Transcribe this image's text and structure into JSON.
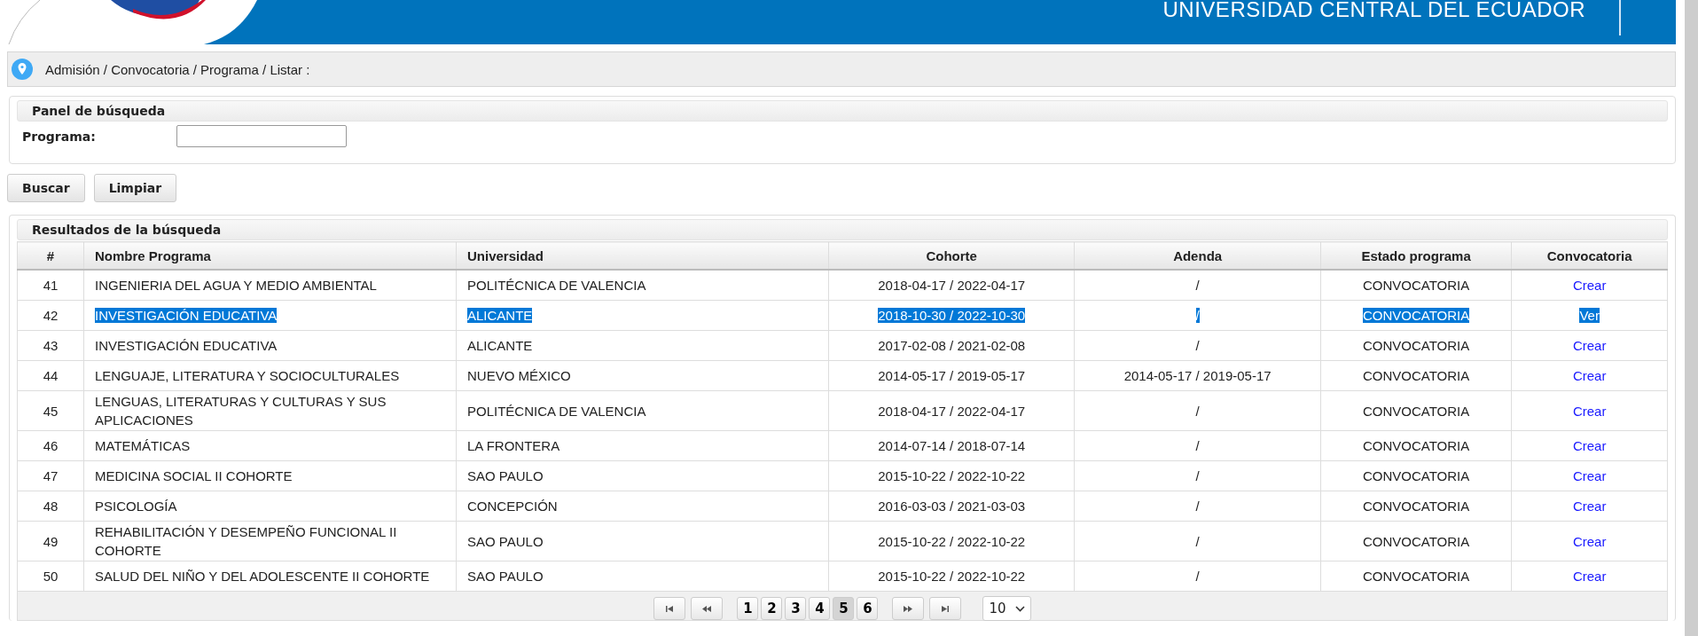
{
  "header": {
    "title": "UNIVERSIDAD CENTRAL DEL ECUADOR"
  },
  "breadcrumb": "Admisión / Convocatoria / Programa / Listar :",
  "search_panel": {
    "title": "Panel de búsqueda",
    "label": "Programa:"
  },
  "buttons": [
    "Buscar",
    "Limpiar"
  ],
  "results": {
    "title": "Resultados de la búsqueda",
    "columns": [
      "#",
      "Nombre Programa",
      "Universidad",
      "Cohorte",
      "Adenda",
      "Estado programa",
      "Convocatoria"
    ],
    "rows": [
      {
        "n": "41",
        "programa": "INGENIERIA DEL AGUA Y MEDIO AMBIENTAL",
        "universidad": "POLITÉCNICA DE VALENCIA",
        "cohorte": "2018-04-17 / 2022-04-17",
        "adenda": "/",
        "estado": "CONVOCATORIA",
        "accion": "Crear",
        "selected": false
      },
      {
        "n": "42",
        "programa": "INVESTIGACIÓN EDUCATIVA",
        "universidad": "ALICANTE",
        "cohorte": "2018-10-30 / 2022-10-30",
        "adenda": "/",
        "estado": "CONVOCATORIA",
        "accion": "Ver",
        "selected": true
      },
      {
        "n": "43",
        "programa": "INVESTIGACIÓN EDUCATIVA",
        "universidad": "ALICANTE",
        "cohorte": "2017-02-08 / 2021-02-08",
        "adenda": "/",
        "estado": "CONVOCATORIA",
        "accion": "Crear",
        "selected": false
      },
      {
        "n": "44",
        "programa": "LENGUAJE, LITERATURA Y SOCIOCULTURALES",
        "universidad": "NUEVO MÉXICO",
        "cohorte": "2014-05-17 / 2019-05-17",
        "adenda": "2014-05-17 / 2019-05-17",
        "estado": "CONVOCATORIA",
        "accion": "Crear",
        "selected": false
      },
      {
        "n": "45",
        "programa": "LENGUAS, LITERATURAS Y CULTURAS Y SUS APLICACIONES",
        "universidad": "POLITÉCNICA DE VALENCIA",
        "cohorte": "2018-04-17 / 2022-04-17",
        "adenda": "/",
        "estado": "CONVOCATORIA",
        "accion": "Crear",
        "selected": false
      },
      {
        "n": "46",
        "programa": "MATEMÁTICAS",
        "universidad": "LA FRONTERA",
        "cohorte": "2014-07-14 / 2018-07-14",
        "adenda": "/",
        "estado": "CONVOCATORIA",
        "accion": "Crear",
        "selected": false
      },
      {
        "n": "47",
        "programa": "MEDICINA SOCIAL II COHORTE",
        "universidad": "SAO PAULO",
        "cohorte": "2015-10-22 / 2022-10-22",
        "adenda": "/",
        "estado": "CONVOCATORIA",
        "accion": "Crear",
        "selected": false
      },
      {
        "n": "48",
        "programa": "PSICOLOGÍA",
        "universidad": "CONCEPCIÓN",
        "cohorte": "2016-03-03 / 2021-03-03",
        "adenda": "/",
        "estado": "CONVOCATORIA",
        "accion": "Crear",
        "selected": false
      },
      {
        "n": "49",
        "programa": "REHABILITACIÓN Y DESEMPEÑO FUNCIONAL II COHORTE",
        "universidad": "SAO PAULO",
        "cohorte": "2015-10-22 / 2022-10-22",
        "adenda": "/",
        "estado": "CONVOCATORIA",
        "accion": "Crear",
        "selected": false
      },
      {
        "n": "50",
        "programa": "SALUD DEL NIÑO Y DEL ADOLESCENTE II COHORTE",
        "universidad": "SAO PAULO",
        "cohorte": "2015-10-22 / 2022-10-22",
        "adenda": "/",
        "estado": "CONVOCATORIA",
        "accion": "Crear",
        "selected": false
      }
    ]
  },
  "pagination": {
    "pages": [
      {
        "label": "1",
        "selected": false
      },
      {
        "label": "2",
        "selected": false
      },
      {
        "label": "3",
        "selected": false
      },
      {
        "label": "4",
        "selected": false
      },
      {
        "label": "5",
        "selected": true
      },
      {
        "label": "6",
        "selected": false
      }
    ],
    "page_size": "10"
  }
}
